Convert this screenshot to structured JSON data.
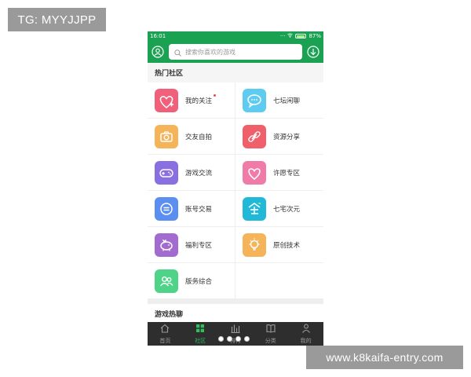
{
  "overlays": {
    "tag": "TG: MYYJJPP",
    "url": "www.k8kaifa-entry.com"
  },
  "status_bar": {
    "time": "16:01",
    "battery": "87%",
    "battery_level": 0.87
  },
  "header": {
    "search_placeholder": "搜索你喜欢的游戏"
  },
  "sections": {
    "hot_community": "热门社区",
    "game_chat": "游戏热聊"
  },
  "grid_items": [
    {
      "label": "我的关注",
      "icon": "heart-plus-icon",
      "color": "#f0607a",
      "dot": true
    },
    {
      "label": "七坛闲聊",
      "icon": "chat-bubble-icon",
      "color": "#5ecbf0",
      "dot": false
    },
    {
      "label": "交友自拍",
      "icon": "camera-icon",
      "color": "#f6b45a",
      "dot": false
    },
    {
      "label": "资源分享",
      "icon": "link-icon",
      "color": "#f0606a",
      "dot": false
    },
    {
      "label": "游戏交流",
      "icon": "gamepad-icon",
      "color": "#8a6fe0",
      "dot": false
    },
    {
      "label": "许愿专区",
      "icon": "heart-icon",
      "color": "#f07aa8",
      "dot": false
    },
    {
      "label": "账号交易",
      "icon": "coin-icon",
      "color": "#5a8ef0",
      "dot": false
    },
    {
      "label": "七宅次元",
      "icon": "house-char-icon",
      "color": "#22b8d8",
      "dot": false
    },
    {
      "label": "福利专区",
      "icon": "piggy-bank-icon",
      "color": "#a36bd0",
      "dot": false
    },
    {
      "label": "原创技术",
      "icon": "lightbulb-icon",
      "color": "#f6b45a",
      "dot": false
    },
    {
      "label": "版务综合",
      "icon": "users-icon",
      "color": "#4fd389",
      "dot": false
    }
  ],
  "tabs": [
    {
      "label": "首页",
      "icon": "home-icon"
    },
    {
      "label": "社区",
      "icon": "grid-icon",
      "active": true
    },
    {
      "label": "排行",
      "icon": "bar-chart-icon"
    },
    {
      "label": "分类",
      "icon": "book-icon"
    },
    {
      "label": "我的",
      "icon": "person-icon"
    }
  ],
  "colors": {
    "brand_green": "#1aa152",
    "tab_bar": "#2e2e2e",
    "tab_active": "#2fbf5c"
  }
}
